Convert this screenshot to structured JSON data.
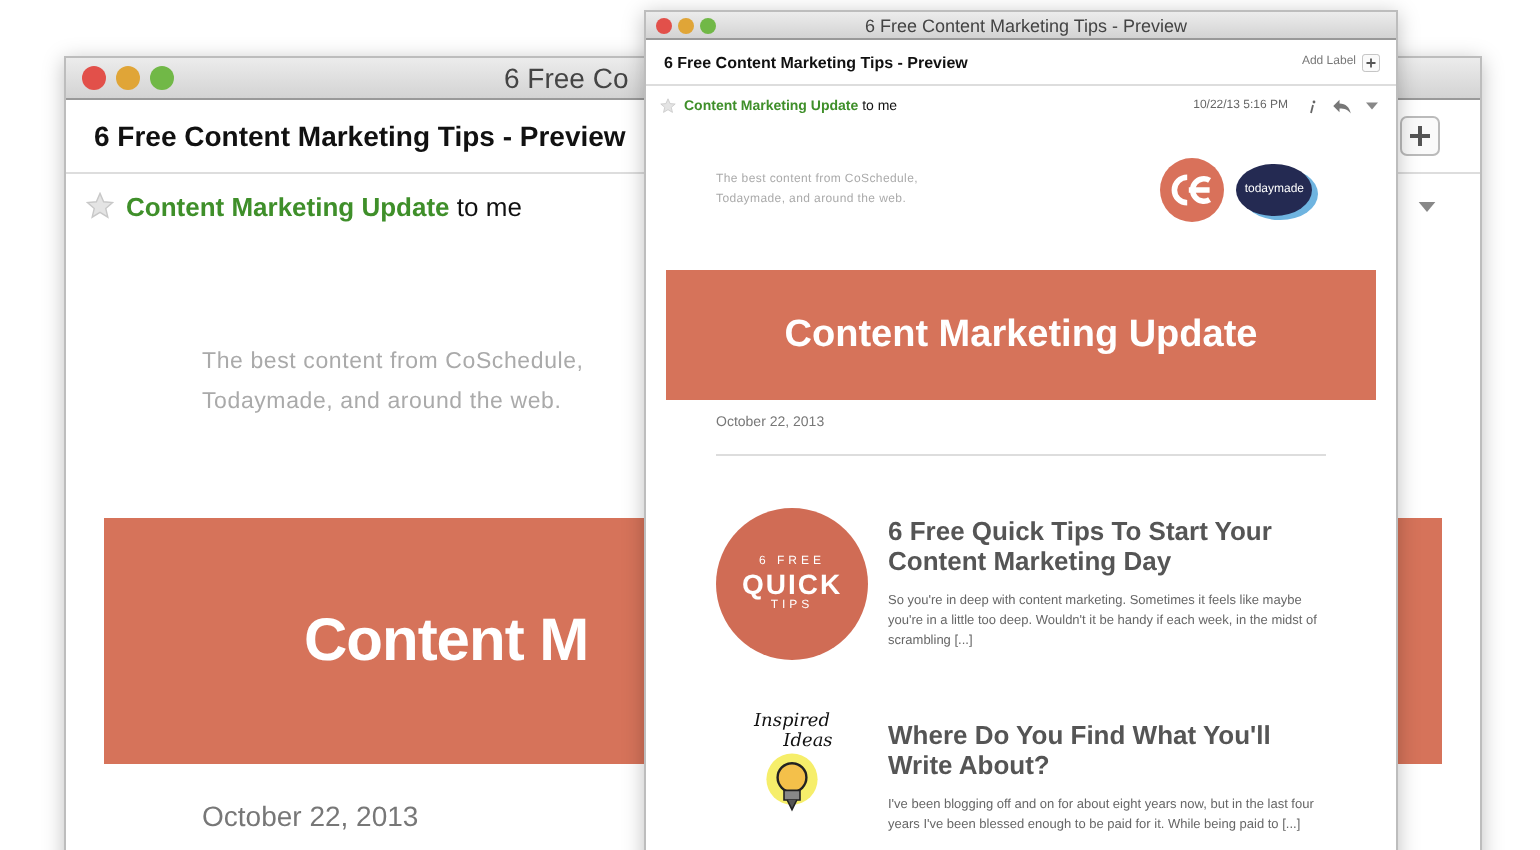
{
  "back_window": {
    "title": "6 Free Co",
    "subject": "6 Free Content Marketing Tips - Preview",
    "sender": "Content Marketing Update",
    "recipient": "to me",
    "starred": false,
    "tagline": [
      "The best content from CoSchedule,",
      "Todaymade, and around the web."
    ],
    "banner": "Content M",
    "date": "October 22, 2013"
  },
  "front_window": {
    "title": "6 Free Content Marketing Tips - Preview",
    "subject": "6 Free Content Marketing Tips - Preview",
    "add_label": "Add Label",
    "sender": "Content Marketing Update",
    "recipient": "to me",
    "starred": false,
    "timestamp": "10/22/13 5:16 PM",
    "tagline": [
      "The best content from CoSchedule,",
      "Todaymade, and around the web."
    ],
    "logo_text": "todaymade",
    "banner": "Content Marketing Update",
    "date": "October 22, 2013",
    "articles": [
      {
        "kind": "badge",
        "image_text": [
          "6 FREE",
          "QUICK",
          "TIPS"
        ],
        "title": "6 Free Quick Tips To Start Your Content Marketing Day",
        "excerpt": "So you're in deep with content marketing. Sometimes it feels like maybe you're in a little too deep. Wouldn't it be handy if each week, in the midst of scrambling [...]"
      },
      {
        "kind": "sketch",
        "image_text": [
          "Inspired",
          "Ideas"
        ],
        "title": "Where Do You Find What You'll Write About?",
        "excerpt": "I've been blogging off and on for about eight years now, but in the last four years I've been blessed enough to be paid for it. While being paid to [...]"
      }
    ]
  }
}
